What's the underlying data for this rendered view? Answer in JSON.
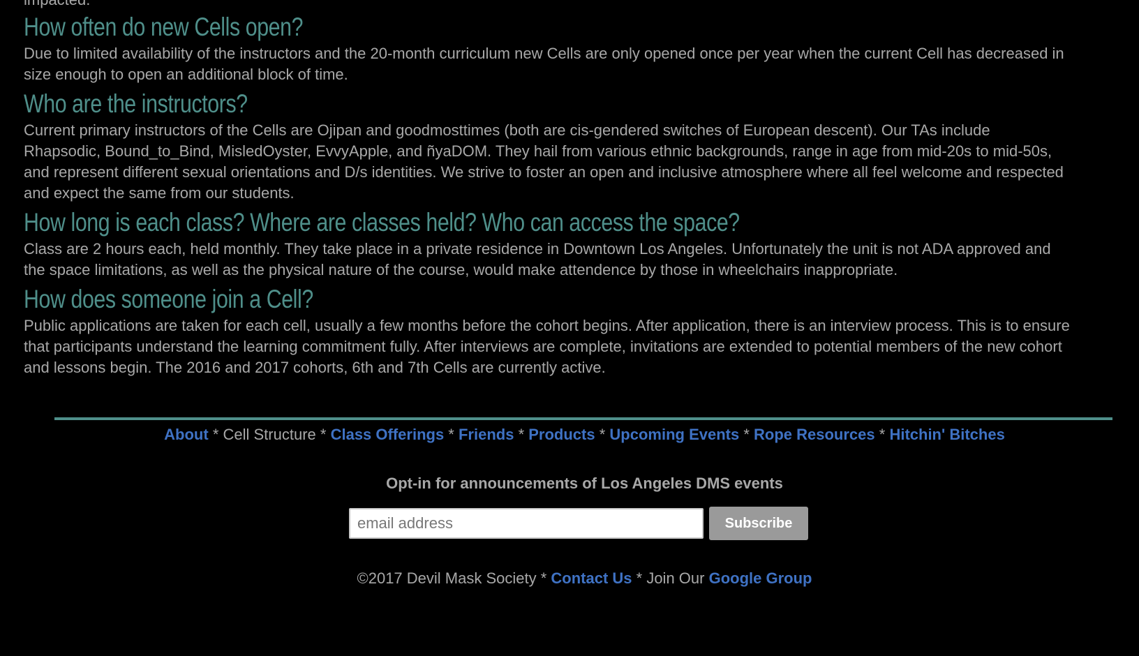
{
  "faq": {
    "clipped_text": "impacted.",
    "items": [
      {
        "question": "How often do new Cells open?",
        "answer": "Due to limited availability of the instructors and the 20-month curriculum new Cells are only opened once per year when the current Cell has decreased in size enough to open an additional block of time."
      },
      {
        "question": "Who are the instructors?",
        "answer": "Current primary instructors of the Cells are Ojipan and goodmosttimes (both are cis-gendered switches of European descent). Our TAs include Rhapsodic, Bound_to_Bind, MisledOyster, EvvyApple, and ñyaDOM. They hail from various ethnic backgrounds, range in age from mid-20s to mid-50s, and represent different sexual orientations and D/s identities. We strive to foster an open and inclusive atmosphere where all feel welcome and respected and expect the same from our students."
      },
      {
        "question": "How long is each class? Where are classes held? Who can access the space?",
        "answer": "Class are 2 hours each, held monthly. They take place in a private residence in Downtown Los Angeles. Unfortunately the unit is not ADA approved and the space limitations, as well as the physical nature of the course, would make attendence by those in wheelchairs inappropriate."
      },
      {
        "question": "How does someone join a Cell?",
        "answer": "Public applications are taken for each cell, usually a few months before the cohort begins. After application, there is an interview process. This is to ensure that participants understand the learning commitment fully. After interviews are complete, invitations are extended to potential members of the new cohort and lessons begin. The 2016 and 2017 cohorts, 6th and 7th Cells are currently active."
      }
    ]
  },
  "footer_nav": {
    "separator": " * ",
    "items": [
      {
        "label": "About",
        "link": true
      },
      {
        "label": "Cell Structure",
        "link": false
      },
      {
        "label": "Class Offerings",
        "link": true
      },
      {
        "label": "Friends",
        "link": true
      },
      {
        "label": "Products",
        "link": true
      },
      {
        "label": "Upcoming Events",
        "link": true
      },
      {
        "label": "Rope Resources",
        "link": true
      },
      {
        "label": "Hitchin' Bitches",
        "link": true
      }
    ]
  },
  "optin": {
    "heading": "Opt-in for announcements of Los Angeles DMS events",
    "email_placeholder": "email address",
    "email_value": "",
    "subscribe_label": "Subscribe"
  },
  "copyright": {
    "text": "©2017 Devil Mask Society",
    "sep1": " * ",
    "contact_label": "Contact Us",
    "join_text": " * Join Our ",
    "group_label": "Google Group"
  },
  "colors": {
    "background": "#000000",
    "heading": "#4f8f8a",
    "body_text": "#a8a8a8",
    "link": "#3f72c4",
    "divider": "#4f8f8a",
    "button": "#9a9a9a"
  }
}
